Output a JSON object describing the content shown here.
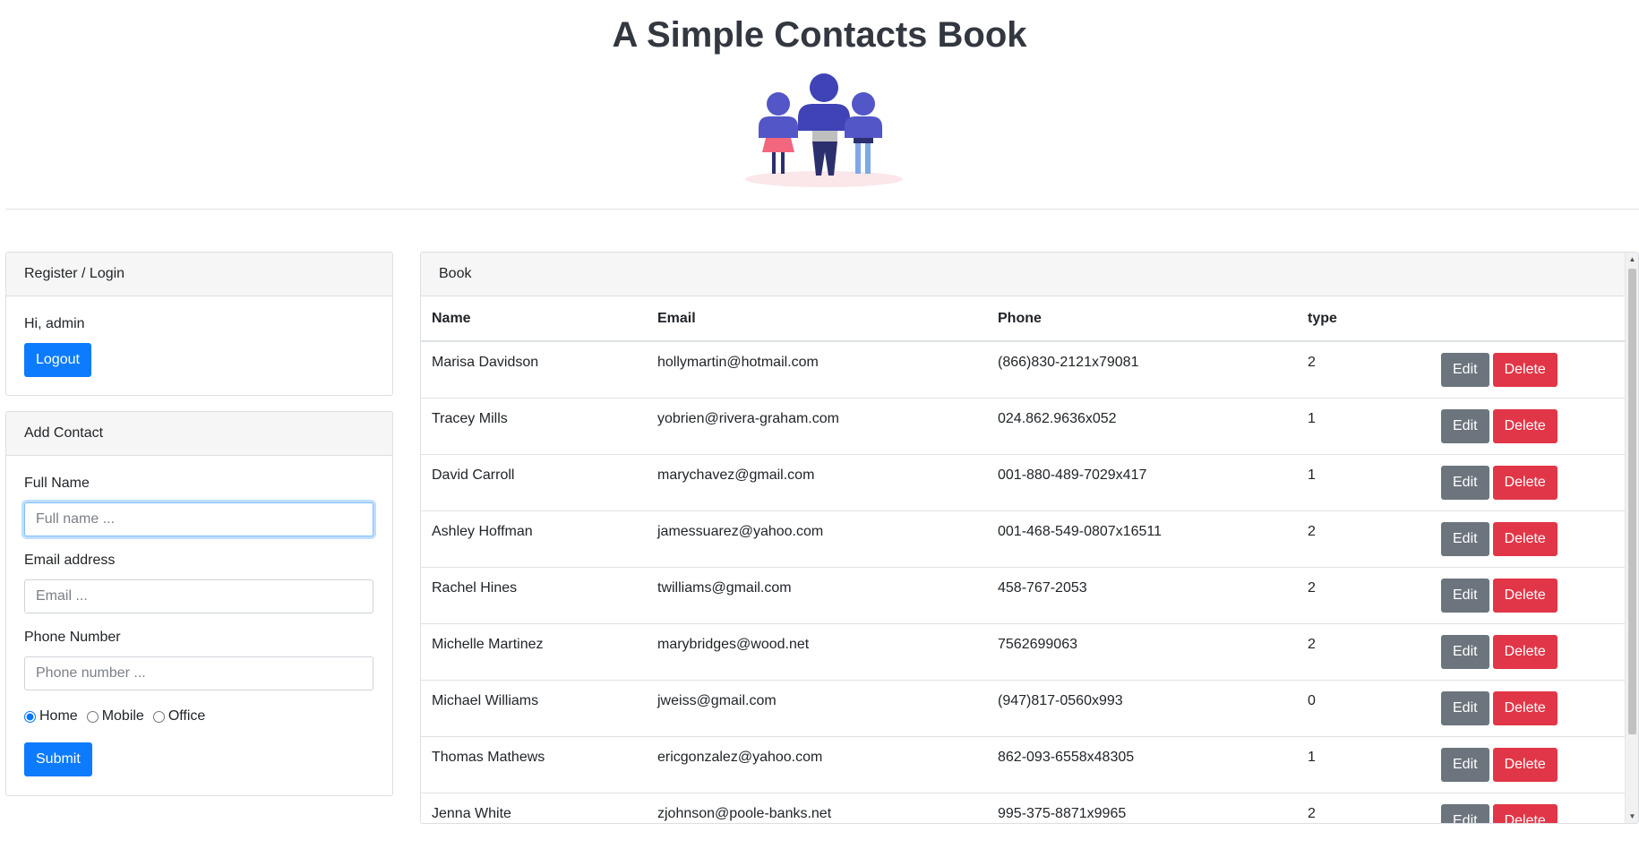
{
  "page": {
    "title": "A Simple Contacts Book"
  },
  "auth_card": {
    "header": "Register / Login",
    "greeting": "Hi, admin",
    "logout_label": "Logout"
  },
  "add_contact": {
    "header": "Add Contact",
    "full_name_label": "Full Name",
    "full_name_placeholder": "Full name ...",
    "email_label": "Email address",
    "email_placeholder": "Email ...",
    "phone_label": "Phone Number",
    "phone_placeholder": "Phone number ...",
    "type_options": [
      "Home",
      "Mobile",
      "Office"
    ],
    "selected_type": "Home",
    "submit_label": "Submit"
  },
  "book": {
    "header": "Book",
    "columns": [
      "Name",
      "Email",
      "Phone",
      "type"
    ],
    "edit_label": "Edit",
    "delete_label": "Delete",
    "rows": [
      {
        "name": "Marisa Davidson",
        "email": "hollymartin@hotmail.com",
        "phone": "(866)830-2121x79081",
        "type": "2"
      },
      {
        "name": "Tracey Mills",
        "email": "yobrien@rivera-graham.com",
        "phone": "024.862.9636x052",
        "type": "1"
      },
      {
        "name": "David Carroll",
        "email": "marychavez@gmail.com",
        "phone": "001-880-489-7029x417",
        "type": "1"
      },
      {
        "name": "Ashley Hoffman",
        "email": "jamessuarez@yahoo.com",
        "phone": "001-468-549-0807x16511",
        "type": "2"
      },
      {
        "name": "Rachel Hines",
        "email": "twilliams@gmail.com",
        "phone": "458-767-2053",
        "type": "2"
      },
      {
        "name": "Michelle Martinez",
        "email": "marybridges@wood.net",
        "phone": "7562699063",
        "type": "2"
      },
      {
        "name": "Michael Williams",
        "email": "jweiss@gmail.com",
        "phone": "(947)817-0560x993",
        "type": "0"
      },
      {
        "name": "Thomas Mathews",
        "email": "ericgonzalez@yahoo.com",
        "phone": "862-093-6558x48305",
        "type": "1"
      },
      {
        "name": "Jenna White",
        "email": "zjohnson@poole-banks.net",
        "phone": "995-375-8871x9965",
        "type": "2"
      }
    ]
  },
  "colors": {
    "primary": "#0d7bfe",
    "secondary": "#6c757d",
    "danger": "#e13647",
    "illustration": "#5256c7"
  },
  "icons": {
    "hero": "people-group-illustration",
    "scroll_up": "scroll-up-arrow",
    "scroll_down": "scroll-down-arrow"
  }
}
